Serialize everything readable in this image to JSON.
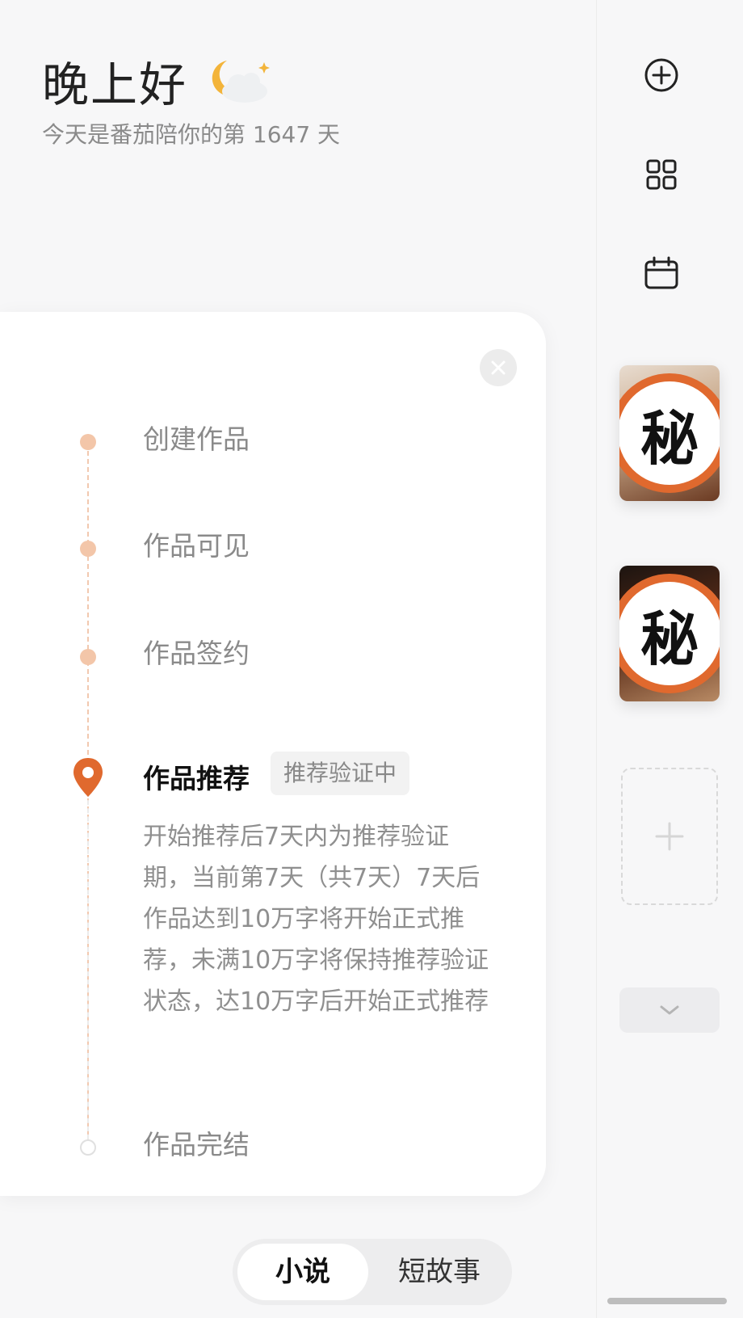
{
  "header": {
    "greeting": "晚上好",
    "weather_icon": "moon-cloud-icon",
    "subtitle": "今天是番茄陪你的第 1647 天"
  },
  "rail": {
    "icons": [
      "add-circle-icon",
      "grid-icon",
      "calendar-icon"
    ],
    "works": [
      {
        "badge": "秘"
      },
      {
        "badge": "秘"
      }
    ],
    "add_slot_icon": "plus-icon",
    "expand_icon": "chevron-down-icon"
  },
  "progress_card": {
    "close_icon": "close-icon",
    "steps": [
      {
        "label": "创建作品",
        "state": "done"
      },
      {
        "label": "作品可见",
        "state": "done"
      },
      {
        "label": "作品签约",
        "state": "done"
      },
      {
        "label": "作品推荐",
        "state": "current",
        "tag": "推荐验证中",
        "description": "开始推荐后7天内为推荐验证期，当前第7天（共7天）7天后作品达到10万字将开始正式推荐，未满10万字将保持推荐验证状态，达10万字后开始正式推荐"
      },
      {
        "label": "作品完结",
        "state": "pending"
      }
    ],
    "accent_color": "#e0692e"
  },
  "bottom_tabs": {
    "items": [
      "小说",
      "短故事"
    ],
    "active_index": 0
  }
}
